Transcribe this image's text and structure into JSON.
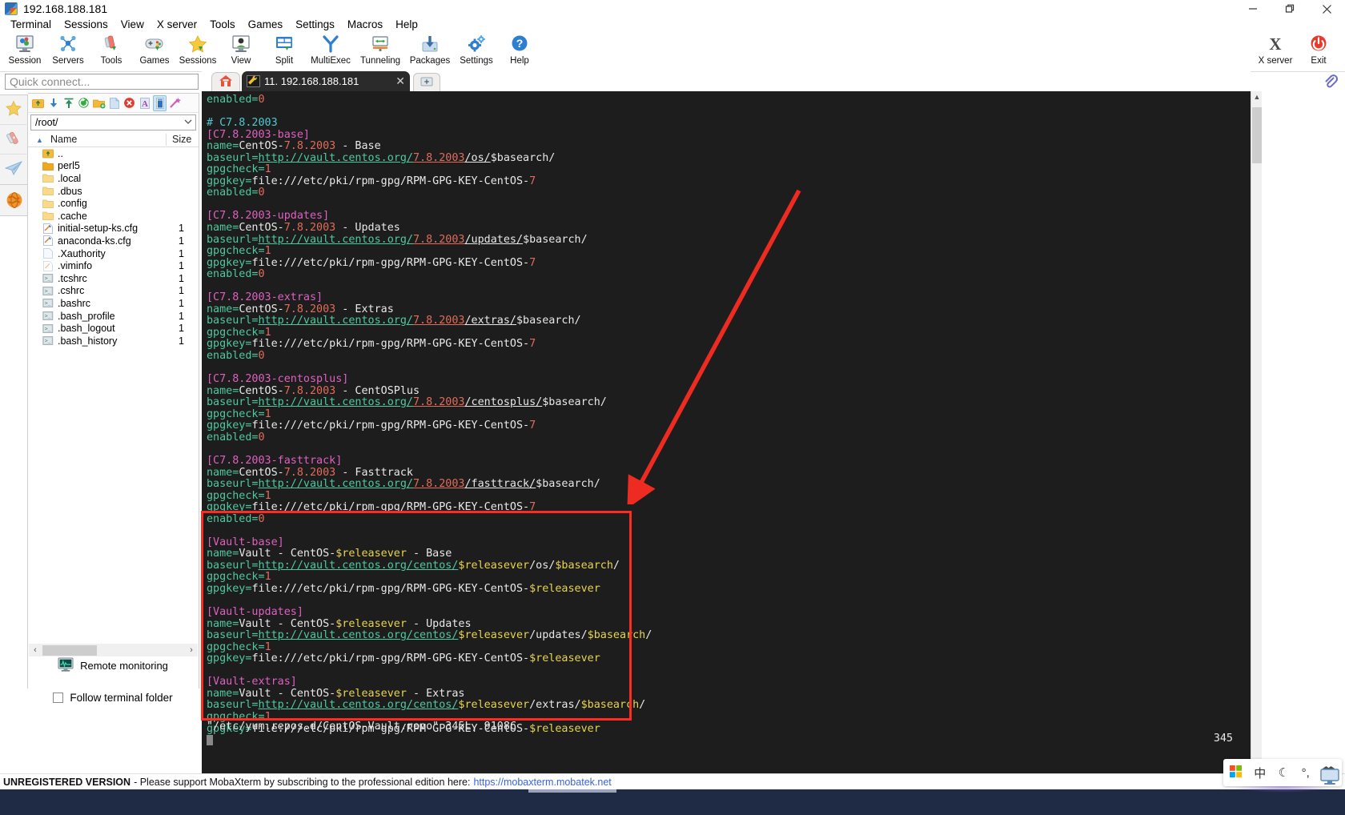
{
  "window": {
    "title": "192.168.188.181",
    "icon": "mobaxterm-logo-icon",
    "minimize": "minimize-icon",
    "maximize": "maximize-icon",
    "close": "close-icon"
  },
  "menubar": {
    "items": [
      "Terminal",
      "Sessions",
      "View",
      "X server",
      "Tools",
      "Games",
      "Settings",
      "Macros",
      "Help"
    ]
  },
  "ribbon": {
    "left_buttons": [
      {
        "label": "Session",
        "icon": "session-icon"
      },
      {
        "label": "Servers",
        "icon": "servers-icon"
      },
      {
        "label": "Tools",
        "icon": "tools-icon"
      },
      {
        "label": "Games",
        "icon": "games-icon"
      },
      {
        "label": "Sessions",
        "icon": "sessions-star-icon"
      },
      {
        "label": "View",
        "icon": "view-icon"
      },
      {
        "label": "Split",
        "icon": "split-icon"
      },
      {
        "label": "MultiExec",
        "icon": "multiexec-icon"
      },
      {
        "label": "Tunneling",
        "icon": "tunneling-icon"
      },
      {
        "label": "Packages",
        "icon": "packages-icon"
      },
      {
        "label": "Settings",
        "icon": "settings-gear-icon"
      },
      {
        "label": "Help",
        "icon": "help-icon"
      }
    ],
    "right_buttons": [
      {
        "label": "X server",
        "icon": "x-server-icon"
      },
      {
        "label": "Exit",
        "icon": "exit-power-icon"
      }
    ]
  },
  "quick_connect": {
    "placeholder": "Quick connect..."
  },
  "rail": {
    "items": [
      {
        "name": "sessions-star-icon"
      },
      {
        "name": "tools-knife-icon"
      },
      {
        "name": "sftp-plane-icon"
      }
    ],
    "bottom": {
      "name": "macros-globe-icon"
    }
  },
  "sftp": {
    "toolbar_icons": [
      "go-up-icon",
      "download-icon",
      "upload-icon",
      "refresh-icon",
      "new-folder-icon",
      "new-file-icon",
      "delete-icon",
      "text-mode-icon",
      "binary-mode-icon",
      "edit-wand-icon"
    ],
    "path": "/root/",
    "path_dropdown": "chevron-down-icon",
    "columns": [
      "Name",
      "Size"
    ],
    "sort_indicator": "sort-asc-icon",
    "rows": [
      {
        "name": "..",
        "size": "",
        "type": "parent"
      },
      {
        "name": "perl5",
        "size": "",
        "type": "folder-open"
      },
      {
        "name": ".local",
        "size": "",
        "type": "folder"
      },
      {
        "name": ".dbus",
        "size": "",
        "type": "folder"
      },
      {
        "name": ".config",
        "size": "",
        "type": "folder"
      },
      {
        "name": ".cache",
        "size": "",
        "type": "folder"
      },
      {
        "name": "initial-setup-ks.cfg",
        "size": "1",
        "type": "cfg"
      },
      {
        "name": "anaconda-ks.cfg",
        "size": "1",
        "type": "cfg"
      },
      {
        "name": ".Xauthority",
        "size": "1",
        "type": "blank"
      },
      {
        "name": ".viminfo",
        "size": "1",
        "type": "cfg-pale"
      },
      {
        "name": ".tcshrc",
        "size": "1",
        "type": "script"
      },
      {
        "name": ".cshrc",
        "size": "1",
        "type": "script"
      },
      {
        "name": ".bashrc",
        "size": "1",
        "type": "script"
      },
      {
        "name": ".bash_profile",
        "size": "1",
        "type": "script"
      },
      {
        "name": ".bash_logout",
        "size": "1",
        "type": "script"
      },
      {
        "name": ".bash_history",
        "size": "1",
        "type": "script"
      }
    ],
    "scroll_left": "‹",
    "scroll_right": "›",
    "remote_monitoring": {
      "label": "Remote monitoring",
      "icon": "monitor-graph-icon"
    },
    "follow_terminal_folder": {
      "label": "Follow terminal folder",
      "checked": false
    }
  },
  "tabs": {
    "home_icon": "home-icon",
    "active": {
      "label": "11. 192.168.188.181",
      "icon": "terminal-wrench-icon",
      "close": "close-icon"
    },
    "new_tab": "add-tab-icon"
  },
  "terminal": {
    "file_open": "/etc/yum.repos.d/CentOS-Vault.repo",
    "status_line": "\"/etc/yum.repos.d/CentOS-Vault.repo\" 345L, 9108C",
    "ruler": "345",
    "lines": [
      {
        "t": "kv",
        "k": "enabled",
        "v": "0",
        "vc": "num"
      },
      {
        "t": "blank"
      },
      {
        "t": "comment",
        "text": "# C7.8.2003"
      },
      {
        "t": "section",
        "text": "[C7.8.2003-base]"
      },
      {
        "t": "kv",
        "k": "name",
        "v": "CentOS-7.8.2003 - Base",
        "vc": "name7"
      },
      {
        "t": "url",
        "k": "baseurl",
        "host": "http://vault.centos.org/",
        "ver": "7.8.2003",
        "path": "/os/",
        "tail": "$basearch/"
      },
      {
        "t": "kv",
        "k": "gpgcheck",
        "v": "1",
        "vc": "num"
      },
      {
        "t": "kv",
        "k": "gpgkey",
        "v": "file:///etc/pki/rpm-gpg/RPM-GPG-KEY-CentOS-7",
        "vc": "gpgkey7"
      },
      {
        "t": "kv",
        "k": "enabled",
        "v": "0",
        "vc": "num"
      },
      {
        "t": "blank"
      },
      {
        "t": "section",
        "text": "[C7.8.2003-updates]"
      },
      {
        "t": "kv",
        "k": "name",
        "v": "CentOS-7.8.2003 - Updates",
        "vc": "name7"
      },
      {
        "t": "url",
        "k": "baseurl",
        "host": "http://vault.centos.org/",
        "ver": "7.8.2003",
        "path": "/updates/",
        "tail": "$basearch/"
      },
      {
        "t": "kv",
        "k": "gpgcheck",
        "v": "1",
        "vc": "num"
      },
      {
        "t": "kv",
        "k": "gpgkey",
        "v": "file:///etc/pki/rpm-gpg/RPM-GPG-KEY-CentOS-7",
        "vc": "gpgkey7"
      },
      {
        "t": "kv",
        "k": "enabled",
        "v": "0",
        "vc": "num"
      },
      {
        "t": "blank"
      },
      {
        "t": "section",
        "text": "[C7.8.2003-extras]"
      },
      {
        "t": "kv",
        "k": "name",
        "v": "CentOS-7.8.2003 - Extras",
        "vc": "name7"
      },
      {
        "t": "url",
        "k": "baseurl",
        "host": "http://vault.centos.org/",
        "ver": "7.8.2003",
        "path": "/extras/",
        "tail": "$basearch/"
      },
      {
        "t": "kv",
        "k": "gpgcheck",
        "v": "1",
        "vc": "num"
      },
      {
        "t": "kv",
        "k": "gpgkey",
        "v": "file:///etc/pki/rpm-gpg/RPM-GPG-KEY-CentOS-7",
        "vc": "gpgkey7"
      },
      {
        "t": "kv",
        "k": "enabled",
        "v": "0",
        "vc": "num"
      },
      {
        "t": "blank"
      },
      {
        "t": "section",
        "text": "[C7.8.2003-centosplus]"
      },
      {
        "t": "kv",
        "k": "name",
        "v": "CentOS-7.8.2003 - CentOSPlus",
        "vc": "name7"
      },
      {
        "t": "url",
        "k": "baseurl",
        "host": "http://vault.centos.org/",
        "ver": "7.8.2003",
        "path": "/centosplus/",
        "tail": "$basearch/"
      },
      {
        "t": "kv",
        "k": "gpgcheck",
        "v": "1",
        "vc": "num"
      },
      {
        "t": "kv",
        "k": "gpgkey",
        "v": "file:///etc/pki/rpm-gpg/RPM-GPG-KEY-CentOS-7",
        "vc": "gpgkey7"
      },
      {
        "t": "kv",
        "k": "enabled",
        "v": "0",
        "vc": "num"
      },
      {
        "t": "blank"
      },
      {
        "t": "section",
        "text": "[C7.8.2003-fasttrack]"
      },
      {
        "t": "kv",
        "k": "name",
        "v": "CentOS-7.8.2003 - Fasttrack",
        "vc": "name7"
      },
      {
        "t": "url",
        "k": "baseurl",
        "host": "http://vault.centos.org/",
        "ver": "7.8.2003",
        "path": "/fasttrack/",
        "tail": "$basearch/"
      },
      {
        "t": "kv",
        "k": "gpgcheck",
        "v": "1",
        "vc": "num"
      },
      {
        "t": "kv",
        "k": "gpgkey",
        "v": "file:///etc/pki/rpm-gpg/RPM-GPG-KEY-CentOS-7",
        "vc": "gpgkey7"
      },
      {
        "t": "kv",
        "k": "enabled",
        "v": "0",
        "vc": "num"
      },
      {
        "t": "blank"
      },
      {
        "t": "section",
        "text": "[Vault-base]"
      },
      {
        "t": "vname",
        "k": "name",
        "pre": "Vault - CentOS-",
        "var": "$releasever",
        "post": " - Base"
      },
      {
        "t": "vurl",
        "k": "baseurl",
        "host": "http://vault.centos.org/centos/",
        "var": "$releasever",
        "mid": "/os/",
        "tailvar": "$basearch",
        "tail": "/"
      },
      {
        "t": "kv",
        "k": "gpgcheck",
        "v": "1",
        "vc": "num"
      },
      {
        "t": "vkey",
        "k": "gpgkey",
        "pre": "file:///etc/pki/rpm-gpg/RPM-GPG-KEY-CentOS-",
        "var": "$releasever"
      },
      {
        "t": "blank"
      },
      {
        "t": "section",
        "text": "[Vault-updates]"
      },
      {
        "t": "vname",
        "k": "name",
        "pre": "Vault - CentOS-",
        "var": "$releasever",
        "post": " - Updates"
      },
      {
        "t": "vurl",
        "k": "baseurl",
        "host": "http://vault.centos.org/centos/",
        "var": "$releasever",
        "mid": "/updates/",
        "tailvar": "$basearch",
        "tail": "/"
      },
      {
        "t": "kv",
        "k": "gpgcheck",
        "v": "1",
        "vc": "num"
      },
      {
        "t": "vkey",
        "k": "gpgkey",
        "pre": "file:///etc/pki/rpm-gpg/RPM-GPG-KEY-CentOS-",
        "var": "$releasever"
      },
      {
        "t": "blank"
      },
      {
        "t": "section",
        "text": "[Vault-extras]"
      },
      {
        "t": "vname",
        "k": "name",
        "pre": "Vault - CentOS-",
        "var": "$releasever",
        "post": " - Extras"
      },
      {
        "t": "vurl",
        "k": "baseurl",
        "host": "http://vault.centos.org/centos/",
        "var": "$releasever",
        "mid": "/extras/",
        "tailvar": "$basearch",
        "tail": "/"
      },
      {
        "t": "kv",
        "k": "gpgcheck",
        "v": "1",
        "vc": "num"
      },
      {
        "t": "vkey",
        "k": "gpgkey",
        "pre": "file:///etc/pki/rpm-gpg/RPM-GPG-KEY-CentOS-",
        "var": "$releasever"
      },
      {
        "t": "cursor"
      }
    ]
  },
  "annotations": {
    "highlight_box_color": "#ff2a20",
    "arrow_color": "#ee2b20",
    "arrow_label": "red-arrow-pointing-to-vault-sections"
  },
  "statusbar": {
    "unregistered_label": "UNREGISTERED VERSION",
    "message": "- Please support MobaXterm by subscribing to the professional edition here:",
    "link": "https://mobaxterm.mobatek.net"
  },
  "tray": {
    "items": [
      {
        "name": "windows-logo-icon",
        "glyph": ""
      },
      {
        "name": "ime-chinese-icon",
        "glyph": "中"
      },
      {
        "name": "moon-icon",
        "glyph": "☾"
      },
      {
        "name": "degree-comma-icon",
        "glyph": "°,"
      },
      {
        "name": "shirt-icon",
        "glyph": ""
      }
    ],
    "monitor_icon": "display-icon"
  },
  "colors": {
    "accent_red": "#ff2a20",
    "terminal_bg": "#1d1d1d",
    "key_green": "#4ec9a0",
    "section_magenta": "#e060c0",
    "number_red": "#e06c5a",
    "var_yellow": "#e8d44d",
    "comment_cyan": "#4ec9d6"
  }
}
